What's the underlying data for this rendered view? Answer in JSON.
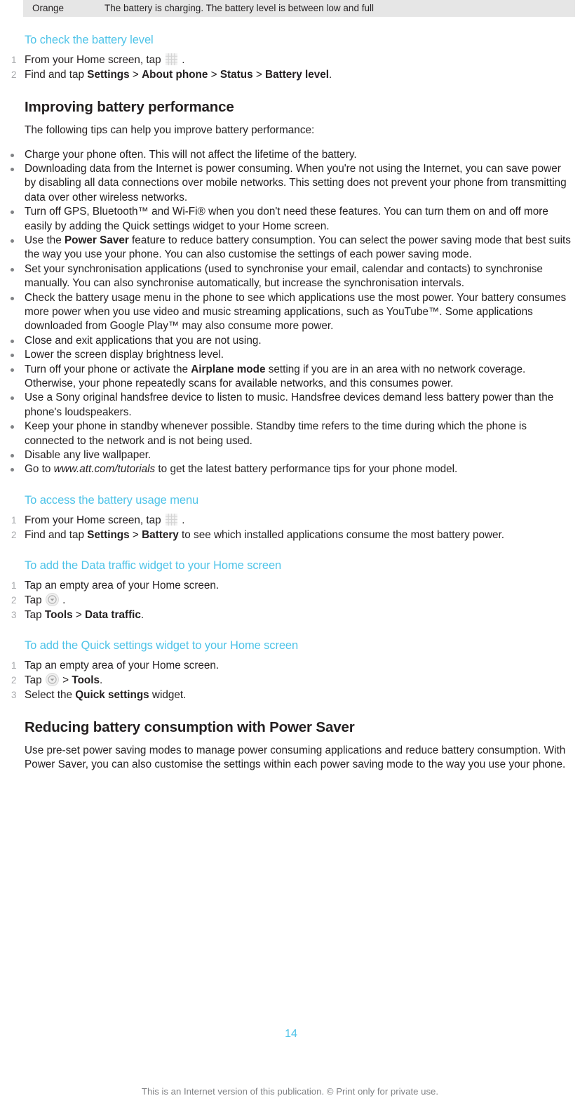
{
  "table_row": {
    "label": "Orange",
    "description": "The battery is charging. The battery level is between low and full"
  },
  "proc_battery_level": {
    "heading": "To check the battery level",
    "steps": [
      {
        "num": "1",
        "pre": "From your Home screen, tap ",
        "icon": "app-grid-icon",
        "post": " ."
      },
      {
        "num": "2",
        "pre": "Find and tap ",
        "b1": "Settings",
        "sep1": " > ",
        "b2": "About phone",
        "sep2": " > ",
        "b3": "Status",
        "sep3": " > ",
        "b4": "Battery level",
        "post": "."
      }
    ]
  },
  "section_improving": {
    "heading": "Improving battery performance",
    "intro": "The following tips can help you improve battery performance:",
    "tips": [
      {
        "text": "Charge your phone often. This will not affect the lifetime of the battery."
      },
      {
        "text": "Downloading data from the Internet is power consuming. When you're not using the Internet, you can save power by disabling all data connections over mobile networks. This setting does not prevent your phone from transmitting data over other wireless networks."
      },
      {
        "text": "Turn off GPS, Bluetooth™ and Wi-Fi® when you don't need these features. You can turn them on and off more easily by adding the Quick settings widget to your Home screen."
      },
      {
        "pre": "Use the ",
        "bold": "Power Saver",
        "post": " feature to reduce battery consumption. You can select the power saving mode that best suits the way you use your phone. You can also customise the settings of each power saving mode."
      },
      {
        "text": "Set your synchronisation applications (used to synchronise your email, calendar and contacts) to synchronise manually. You can also synchronise automatically, but increase the synchronisation intervals."
      },
      {
        "text": "Check the battery usage menu in the phone to see which applications use the most power. Your battery consumes more power when you use video and music streaming applications, such as YouTube™. Some applications downloaded from Google Play™ may also consume more power."
      },
      {
        "text": "Close and exit applications that you are not using."
      },
      {
        "text": "Lower the screen display brightness level."
      },
      {
        "pre": "Turn off your phone or activate the ",
        "bold": "Airplane mode",
        "post": " setting if you are in an area with no network coverage. Otherwise, your phone repeatedly scans for available networks, and this consumes power."
      },
      {
        "text": "Use a Sony original handsfree device to listen to music. Handsfree devices demand less battery power than the phone's loudspeakers."
      },
      {
        "text": "Keep your phone in standby whenever possible. Standby time refers to the time during which the phone is connected to the network and is not being used."
      },
      {
        "text": "Disable any live wallpaper."
      },
      {
        "pre": "Go to ",
        "italic": "www.att.com/tutorials",
        "post": " to get the latest battery performance tips for your phone model."
      }
    ]
  },
  "proc_usage_menu": {
    "heading": "To access the battery usage menu",
    "steps": [
      {
        "num": "1",
        "pre": "From your Home screen, tap ",
        "icon": "app-grid-icon",
        "post": " ."
      },
      {
        "num": "2",
        "pre": "Find and tap ",
        "b1": "Settings",
        "sep1": " > ",
        "b2": "Battery",
        "post": " to see which installed applications consume the most battery power."
      }
    ]
  },
  "proc_data_traffic": {
    "heading": "To add the Data traffic widget to your Home screen",
    "steps": [
      {
        "num": "1",
        "text": "Tap an empty area of your Home screen."
      },
      {
        "num": "2",
        "pre": "Tap ",
        "icon": "add-widget-circle-icon",
        "post": "."
      },
      {
        "num": "3",
        "pre": "Tap ",
        "b1": "Tools",
        "sep1": " > ",
        "b2": "Data traffic",
        "post": "."
      }
    ]
  },
  "proc_quick_settings": {
    "heading": "To add the Quick settings widget to your Home screen",
    "steps": [
      {
        "num": "1",
        "text": "Tap an empty area of your Home screen."
      },
      {
        "num": "2",
        "pre": "Tap ",
        "icon": "add-widget-circle-icon",
        "sep1": " > ",
        "b1": "Tools",
        "post": "."
      },
      {
        "num": "3",
        "pre": "Select the ",
        "b1": "Quick settings",
        "post": " widget."
      }
    ]
  },
  "section_power_saver": {
    "heading": "Reducing battery consumption with Power Saver",
    "body": "Use pre-set power saving modes to manage power consuming applications and reduce battery consumption. With Power Saver, you can also customise the settings within each power saving mode to the way you use your phone."
  },
  "footer": {
    "page_number": "14",
    "note": "This is an Internet version of this publication. © Print only for private use."
  },
  "colors": {
    "heading_accent": "#4ec3e8",
    "body_text": "#231f20",
    "table_band": "#e6e6e6",
    "bullet": "#808285",
    "step_number": "#a7a9ac",
    "footer_note": "#808285"
  }
}
